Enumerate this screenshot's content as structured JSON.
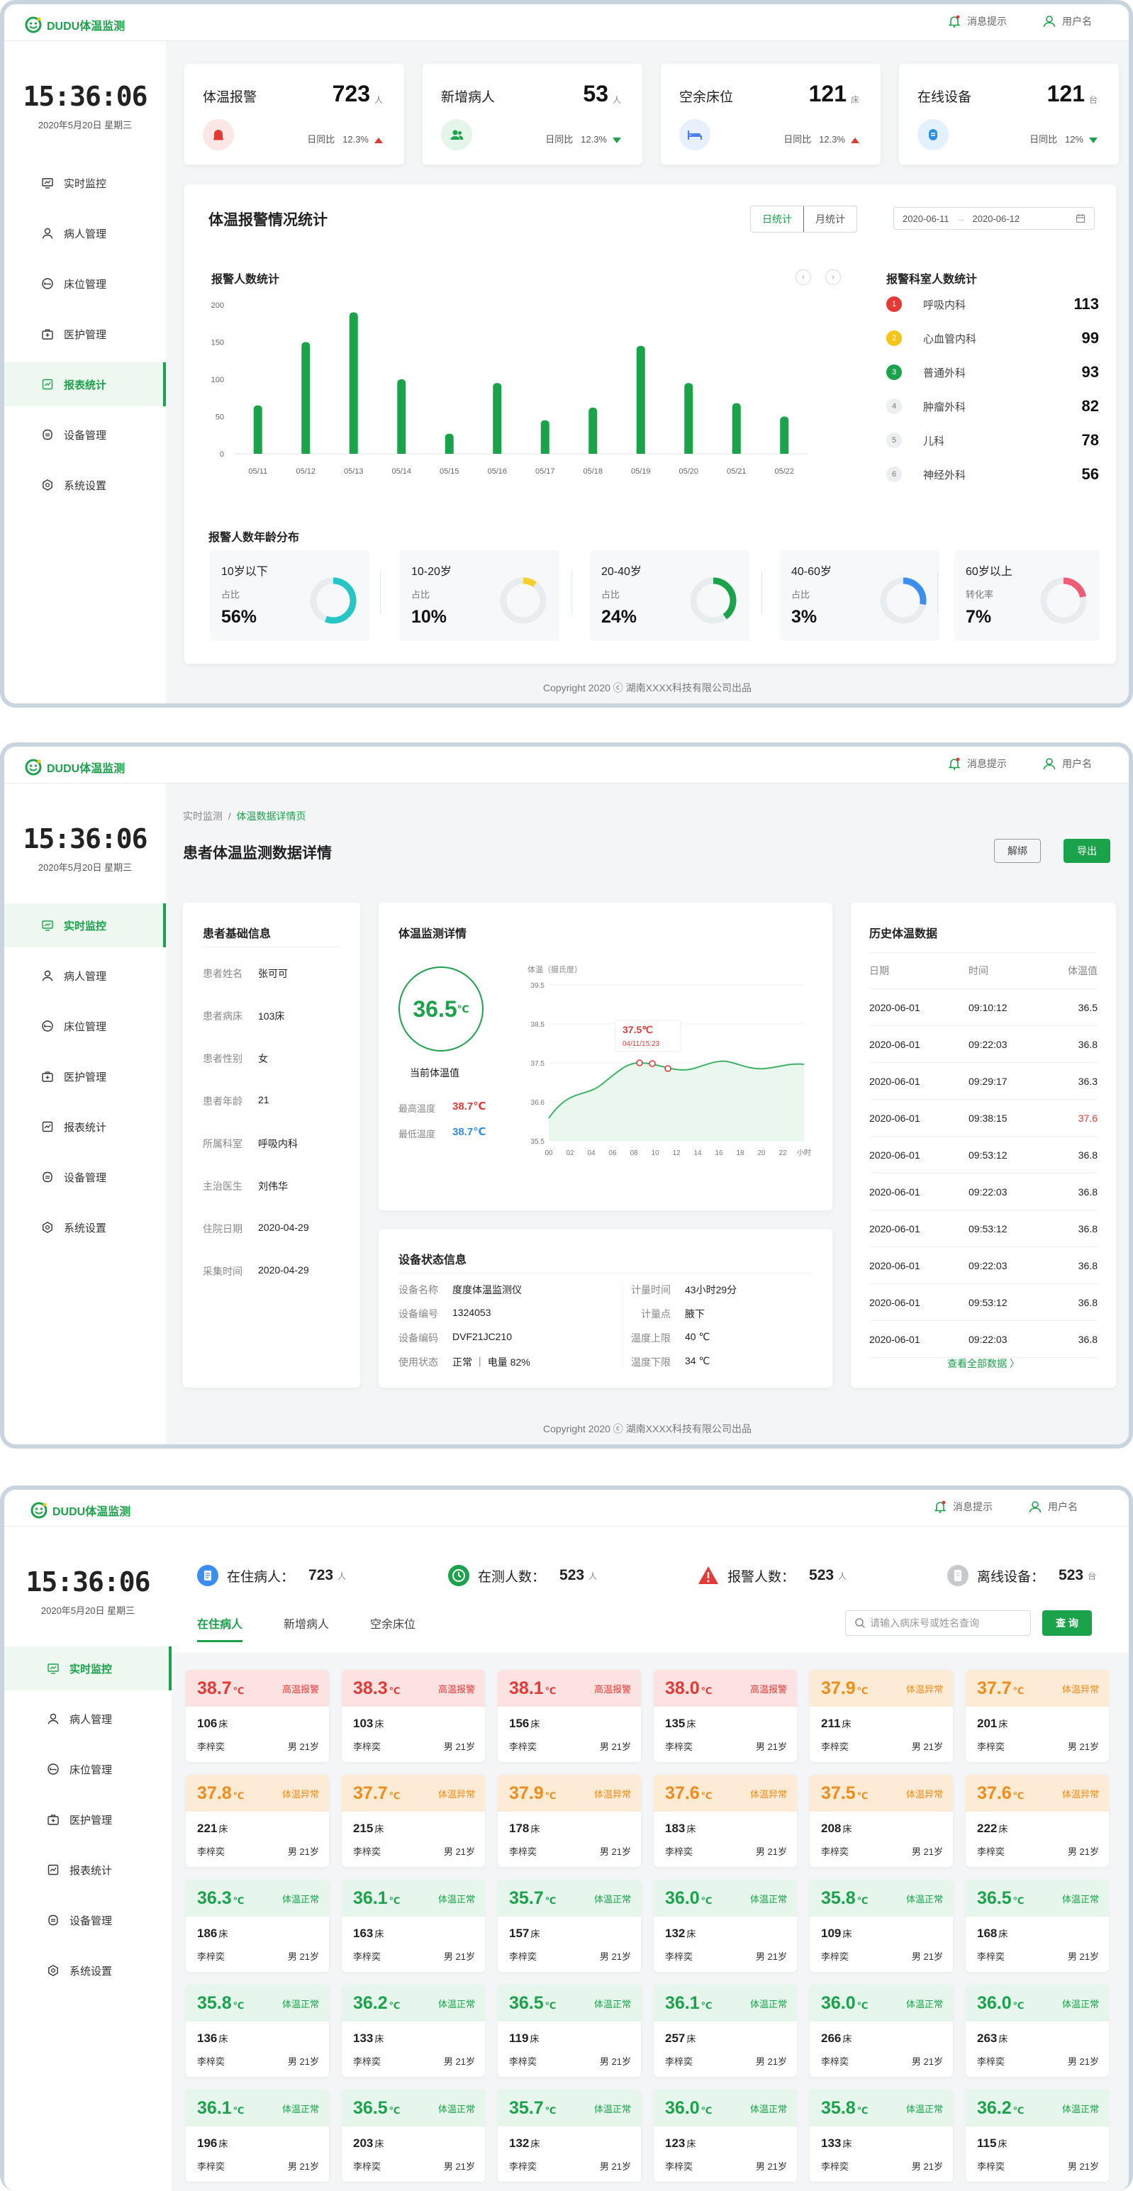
{
  "app": {
    "brand": "DUDU体温监测",
    "notice": "消息提示",
    "user": "用户名",
    "clock_time": "15:36:06",
    "clock_date": "2020年5月20日 星期三",
    "footer": "Copyright 2020 ⓒ  湖南XXXX科技有限公司出品",
    "menu": [
      "实时监控",
      "病人管理",
      "床位管理",
      "医护管理",
      "报表统计",
      "设备管理",
      "系统设置"
    ]
  },
  "dashboard": {
    "stats": [
      {
        "label": "体温报警",
        "value": "723",
        "unit": "人",
        "cmp_label": "日同比",
        "pct": "12.3%",
        "trend": "up"
      },
      {
        "label": "新增病人",
        "value": "53",
        "unit": "人",
        "cmp_label": "日同比",
        "pct": "12.3%",
        "trend": "down"
      },
      {
        "label": "空余床位",
        "value": "121",
        "unit": "床",
        "cmp_label": "日同比",
        "pct": "12.3%",
        "trend": "up"
      },
      {
        "label": "在线设备",
        "value": "121",
        "unit": "台",
        "cmp_label": "日同比",
        "pct": "12%",
        "trend": "down"
      }
    ],
    "title": "体温报警情况统计",
    "toggle": [
      "日统计",
      "月统计"
    ],
    "date_from": "2020-06-11",
    "date_to": "2020-06-12",
    "bar_title": "报警人数统计",
    "dept_title": "报警科室人数统计",
    "departments": [
      {
        "rank": "1",
        "name": "呼吸内科",
        "value": "113",
        "color": "#e53935"
      },
      {
        "rank": "2",
        "name": "心血管内科",
        "value": "99",
        "color": "#f5c518"
      },
      {
        "rank": "3",
        "name": "普通外科",
        "value": "93",
        "color": "#1aa34a"
      },
      {
        "rank": "4",
        "name": "肿瘤外科",
        "value": "82",
        "color": "#e6e8eb"
      },
      {
        "rank": "5",
        "name": "儿科",
        "value": "78",
        "color": "#e6e8eb"
      },
      {
        "rank": "6",
        "name": "神经外科",
        "value": "56",
        "color": "#e6e8eb"
      }
    ],
    "age_title": "报警人数年龄分布",
    "ages": [
      {
        "label": "10岁以下",
        "sub": "占比",
        "value": "56%",
        "frac": 0.56,
        "color": "#26c6c6"
      },
      {
        "label": "10-20岁",
        "sub": "占比",
        "value": "10%",
        "frac": 0.1,
        "color": "#f5d02e"
      },
      {
        "label": "20-40岁",
        "sub": "占比",
        "value": "24%",
        "frac": 0.4,
        "color": "#1aa34a"
      },
      {
        "label": "40-60岁",
        "sub": "占比",
        "value": "3%",
        "frac": 0.28,
        "color": "#3a8ef0"
      },
      {
        "label": "60岁以上",
        "sub": "转化率",
        "value": "7%",
        "frac": 0.22,
        "color": "#ef5b74"
      }
    ]
  },
  "chart_data": {
    "type": "bar",
    "categories": [
      "05/11",
      "05/12",
      "05/13",
      "05/14",
      "05/15",
      "05/16",
      "05/17",
      "05/18",
      "05/19",
      "05/20",
      "05/21",
      "05/22"
    ],
    "values": [
      65,
      150,
      190,
      100,
      27,
      95,
      45,
      62,
      145,
      95,
      68,
      50
    ],
    "ylim": [
      0,
      200
    ],
    "yticks": [
      "200",
      "150",
      "100",
      "50",
      "0"
    ],
    "color": "#1aa34a",
    "grid": false
  },
  "detail": {
    "crumb_root": "实时监测",
    "crumb_sep": "/",
    "crumb_cur": "体温数据详情页",
    "title": "患者体温监测数据详情",
    "btn_unbind": "解绑",
    "btn_export": "导出",
    "patient_title": "患者基础信息",
    "patient": [
      {
        "k": "患者姓名",
        "v": "张可可"
      },
      {
        "k": "患者病床",
        "v": "103床"
      },
      {
        "k": "患者性别",
        "v": "女"
      },
      {
        "k": "患者年龄",
        "v": "21"
      },
      {
        "k": "所属科室",
        "v": "呼吸内科"
      },
      {
        "k": "主治医生",
        "v": "刘伟华"
      },
      {
        "k": "住院日期",
        "v": "2020-04-29"
      },
      {
        "k": "采集时间",
        "v": "2020-04-29"
      }
    ],
    "monitor_title": "体温监测详情",
    "current_temp": "36.5",
    "temp_unit": "℃",
    "current_label": "当前体温值",
    "max_label": "最高温度",
    "max_value": "38.7℃",
    "min_label": "最低温度",
    "min_value": "38.7℃",
    "line_ylabel": "体温（摄氏度）",
    "line_yticks": [
      "39.5",
      "38.5",
      "37.5",
      "36.6",
      "35.5"
    ],
    "line_xticks": [
      "00",
      "02",
      "04",
      "06",
      "08",
      "10",
      "12",
      "14",
      "16",
      "18",
      "20",
      "22",
      "小时"
    ],
    "tooltip_value": "37.5℃",
    "tooltip_time": "04/11/15:23",
    "device_title": "设备状态信息",
    "device_left": [
      {
        "k": "设备名称",
        "v": "度度体温监测仪"
      },
      {
        "k": "设备编号",
        "v": "1324053"
      },
      {
        "k": "设备编码",
        "v": "DVF21JC210"
      },
      {
        "k": "使用状态",
        "v": "正常 ｜ 电量 82%"
      }
    ],
    "device_right": [
      {
        "k": "计量时间",
        "v": "43小时29分"
      },
      {
        "k": "计量点",
        "v": "腋下"
      },
      {
        "k": "温度上限",
        "v": "40 ℃"
      },
      {
        "k": "温度下限",
        "v": "34 ℃"
      }
    ],
    "history_title": "历史体温数据",
    "history_headers": [
      "日期",
      "时间",
      "体温值"
    ],
    "history": [
      {
        "d": "2020-06-01",
        "t": "09:10:12",
        "v": "36.5"
      },
      {
        "d": "2020-06-01",
        "t": "09:22:03",
        "v": "36.8"
      },
      {
        "d": "2020-06-01",
        "t": "09:29:17",
        "v": "36.3"
      },
      {
        "d": "2020-06-01",
        "t": "09:38:15",
        "v": "37.6"
      },
      {
        "d": "2020-06-01",
        "t": "09:53:12",
        "v": "36.8"
      },
      {
        "d": "2020-06-01",
        "t": "09:22:03",
        "v": "36.8"
      },
      {
        "d": "2020-06-01",
        "t": "09:53:12",
        "v": "36.8"
      },
      {
        "d": "2020-06-01",
        "t": "09:22:03",
        "v": "36.8"
      },
      {
        "d": "2020-06-01",
        "t": "09:53:12",
        "v": "36.8"
      },
      {
        "d": "2020-06-01",
        "t": "09:22:03",
        "v": "36.8"
      }
    ],
    "view_all": "查看全部数据"
  },
  "monitor": {
    "stats": [
      {
        "label": "在住病人：",
        "value": "723",
        "unit": "人",
        "color": "#3a8ef0"
      },
      {
        "label": "在测人数：",
        "value": "523",
        "unit": "人",
        "color": "#1aa34a"
      },
      {
        "label": "报警人数：",
        "value": "523",
        "unit": "人",
        "color": "#e53935"
      },
      {
        "label": "离线设备：",
        "value": "523",
        "unit": "台",
        "color": "#999999"
      }
    ],
    "tabs": [
      "在住病人",
      "新增病人",
      "空余床位"
    ],
    "search_placeholder": "请输入病床号或姓名查询",
    "search_btn": "查 询",
    "cards": [
      {
        "t": "38.7",
        "s": "高温报警",
        "bed": "106",
        "c": "red"
      },
      {
        "t": "38.3",
        "s": "高温报警",
        "bed": "103",
        "c": "red"
      },
      {
        "t": "38.1",
        "s": "高温报警",
        "bed": "156",
        "c": "red"
      },
      {
        "t": "38.0",
        "s": "高温报警",
        "bed": "135",
        "c": "red"
      },
      {
        "t": "37.9",
        "s": "体温异常",
        "bed": "211",
        "c": "org"
      },
      {
        "t": "37.7",
        "s": "体温异常",
        "bed": "201",
        "c": "org"
      },
      {
        "t": "37.8",
        "s": "体温异常",
        "bed": "221",
        "c": "org"
      },
      {
        "t": "37.7",
        "s": "体温异常",
        "bed": "215",
        "c": "org"
      },
      {
        "t": "37.9",
        "s": "体温异常",
        "bed": "178",
        "c": "org"
      },
      {
        "t": "37.6",
        "s": "体温异常",
        "bed": "183",
        "c": "org"
      },
      {
        "t": "37.5",
        "s": "体温异常",
        "bed": "208",
        "c": "org"
      },
      {
        "t": "37.6",
        "s": "体温异常",
        "bed": "222",
        "c": "org"
      },
      {
        "t": "36.3",
        "s": "体温正常",
        "bed": "186",
        "c": "grn"
      },
      {
        "t": "36.1",
        "s": "体温正常",
        "bed": "163",
        "c": "grn"
      },
      {
        "t": "35.7",
        "s": "体温正常",
        "bed": "157",
        "c": "grn"
      },
      {
        "t": "36.0",
        "s": "体温正常",
        "bed": "132",
        "c": "grn"
      },
      {
        "t": "35.8",
        "s": "体温正常",
        "bed": "109",
        "c": "grn"
      },
      {
        "t": "36.5",
        "s": "体温正常",
        "bed": "168",
        "c": "grn"
      },
      {
        "t": "35.8",
        "s": "体温正常",
        "bed": "136",
        "c": "grn"
      },
      {
        "t": "36.2",
        "s": "体温正常",
        "bed": "133",
        "c": "grn"
      },
      {
        "t": "36.5",
        "s": "体温正常",
        "bed": "119",
        "c": "grn"
      },
      {
        "t": "36.1",
        "s": "体温正常",
        "bed": "257",
        "c": "grn"
      },
      {
        "t": "36.0",
        "s": "体温正常",
        "bed": "266",
        "c": "grn"
      },
      {
        "t": "36.0",
        "s": "体温正常",
        "bed": "263",
        "c": "grn"
      },
      {
        "t": "36.1",
        "s": "体温正常",
        "bed": "196",
        "c": "grn"
      },
      {
        "t": "36.5",
        "s": "体温正常",
        "bed": "203",
        "c": "grn"
      },
      {
        "t": "35.7",
        "s": "体温正常",
        "bed": "132",
        "c": "grn"
      },
      {
        "t": "36.0",
        "s": "体温正常",
        "bed": "123",
        "c": "grn"
      },
      {
        "t": "35.8",
        "s": "体温正常",
        "bed": "133",
        "c": "grn"
      },
      {
        "t": "36.2",
        "s": "体温正常",
        "bed": "115",
        "c": "grn"
      }
    ],
    "bed_unit": "床",
    "temp_unit": "℃",
    "name": "李梓奕",
    "gender_age": "男   21岁"
  }
}
